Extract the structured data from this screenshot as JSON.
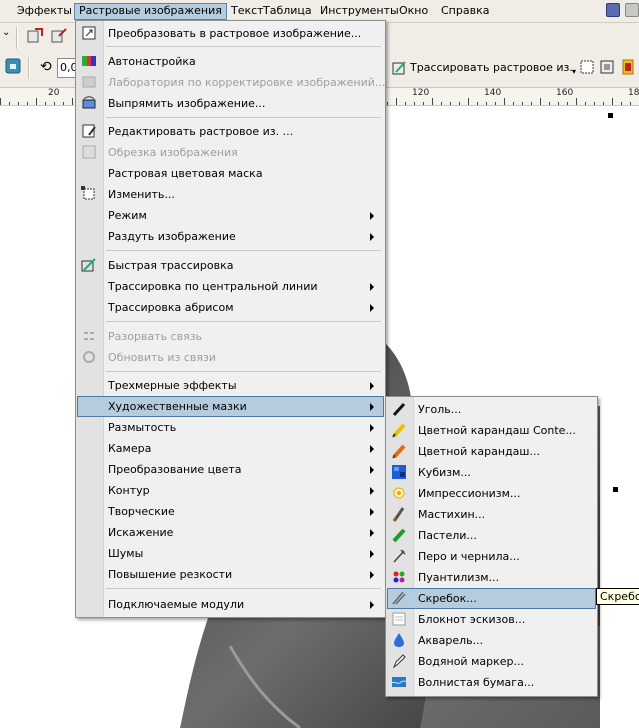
{
  "menubar": {
    "items": [
      {
        "label": "Эффекты"
      },
      {
        "label": "Растровые изображения"
      },
      {
        "label": "Текст"
      },
      {
        "label": "Таблица"
      },
      {
        "label": "Инструменты"
      },
      {
        "label": "Окно"
      },
      {
        "label": "Справка"
      }
    ]
  },
  "toolbar": {
    "number_value": "0,0",
    "trace_button": "Трассировать растровое из."
  },
  "ruler": {
    "labels": [
      "20",
      "120",
      "140",
      "160",
      "18"
    ]
  },
  "bitmaps_menu": {
    "items": [
      {
        "label": "Преобразовать в растровое изображение...",
        "icon": "convert-to-bitmap-icon"
      },
      {
        "label": "Автонастройка",
        "icon": "auto-adjust-icon"
      },
      {
        "label": "Лаборатория по корректировке изображений...",
        "icon": "image-adjustment-lab-icon"
      },
      {
        "label": "Выпрямить изображение...",
        "icon": "straighten-icon"
      },
      {
        "label": "Редактировать растровое из. ...",
        "icon": "edit-bitmap-icon"
      },
      {
        "label": "Обрезка изображения",
        "icon": "crop-bitmap-icon"
      },
      {
        "label": "Растровая цветовая маска",
        "icon": ""
      },
      {
        "label": "Изменить...",
        "icon": "resample-icon"
      },
      {
        "label": "Режим",
        "icon": ""
      },
      {
        "label": "Раздуть изображение",
        "icon": ""
      },
      {
        "label": "Быстрая трассировка",
        "icon": "quick-trace-icon"
      },
      {
        "label": "Трассировка по центральной линии",
        "icon": ""
      },
      {
        "label": "Трассировка абрисом",
        "icon": ""
      },
      {
        "label": "Разорвать связь",
        "icon": "break-link-icon"
      },
      {
        "label": "Обновить из связи",
        "icon": "update-link-icon"
      },
      {
        "label": "Трехмерные эффекты",
        "icon": ""
      },
      {
        "label": "Художественные мазки",
        "icon": ""
      },
      {
        "label": "Размытость",
        "icon": ""
      },
      {
        "label": "Камера",
        "icon": ""
      },
      {
        "label": "Преобразование цвета",
        "icon": ""
      },
      {
        "label": "Контур",
        "icon": ""
      },
      {
        "label": "Творческие",
        "icon": ""
      },
      {
        "label": "Искажение",
        "icon": ""
      },
      {
        "label": "Шумы",
        "icon": ""
      },
      {
        "label": "Повышение резкости",
        "icon": ""
      },
      {
        "label": "Подключаемые модули",
        "icon": ""
      }
    ]
  },
  "art_strokes_menu": {
    "items": [
      {
        "label": "Уголь...",
        "icon": "charcoal-icon"
      },
      {
        "label": "Цветной карандаш Conte...",
        "icon": "conte-crayon-icon"
      },
      {
        "label": "Цветной карандаш...",
        "icon": "crayon-icon"
      },
      {
        "label": "Кубизм...",
        "icon": "cubist-icon"
      },
      {
        "label": "Импрессионизм...",
        "icon": "impressionist-icon"
      },
      {
        "label": "Мастихин...",
        "icon": "palette-knife-icon"
      },
      {
        "label": "Пастели...",
        "icon": "pastels-icon"
      },
      {
        "label": "Перо и чернила...",
        "icon": "pen-and-ink-icon"
      },
      {
        "label": "Пуантилизм...",
        "icon": "pointillist-icon"
      },
      {
        "label": "Скребок...",
        "icon": "scraperboard-icon"
      },
      {
        "label": "Блокнот эскизов...",
        "icon": "sketch-pad-icon"
      },
      {
        "label": "Акварель...",
        "icon": "watercolor-icon"
      },
      {
        "label": "Водяной маркер...",
        "icon": "water-marker-icon"
      },
      {
        "label": "Волнистая бумага...",
        "icon": "wave-paper-icon"
      }
    ]
  },
  "tooltip": {
    "text": "Скребок"
  }
}
